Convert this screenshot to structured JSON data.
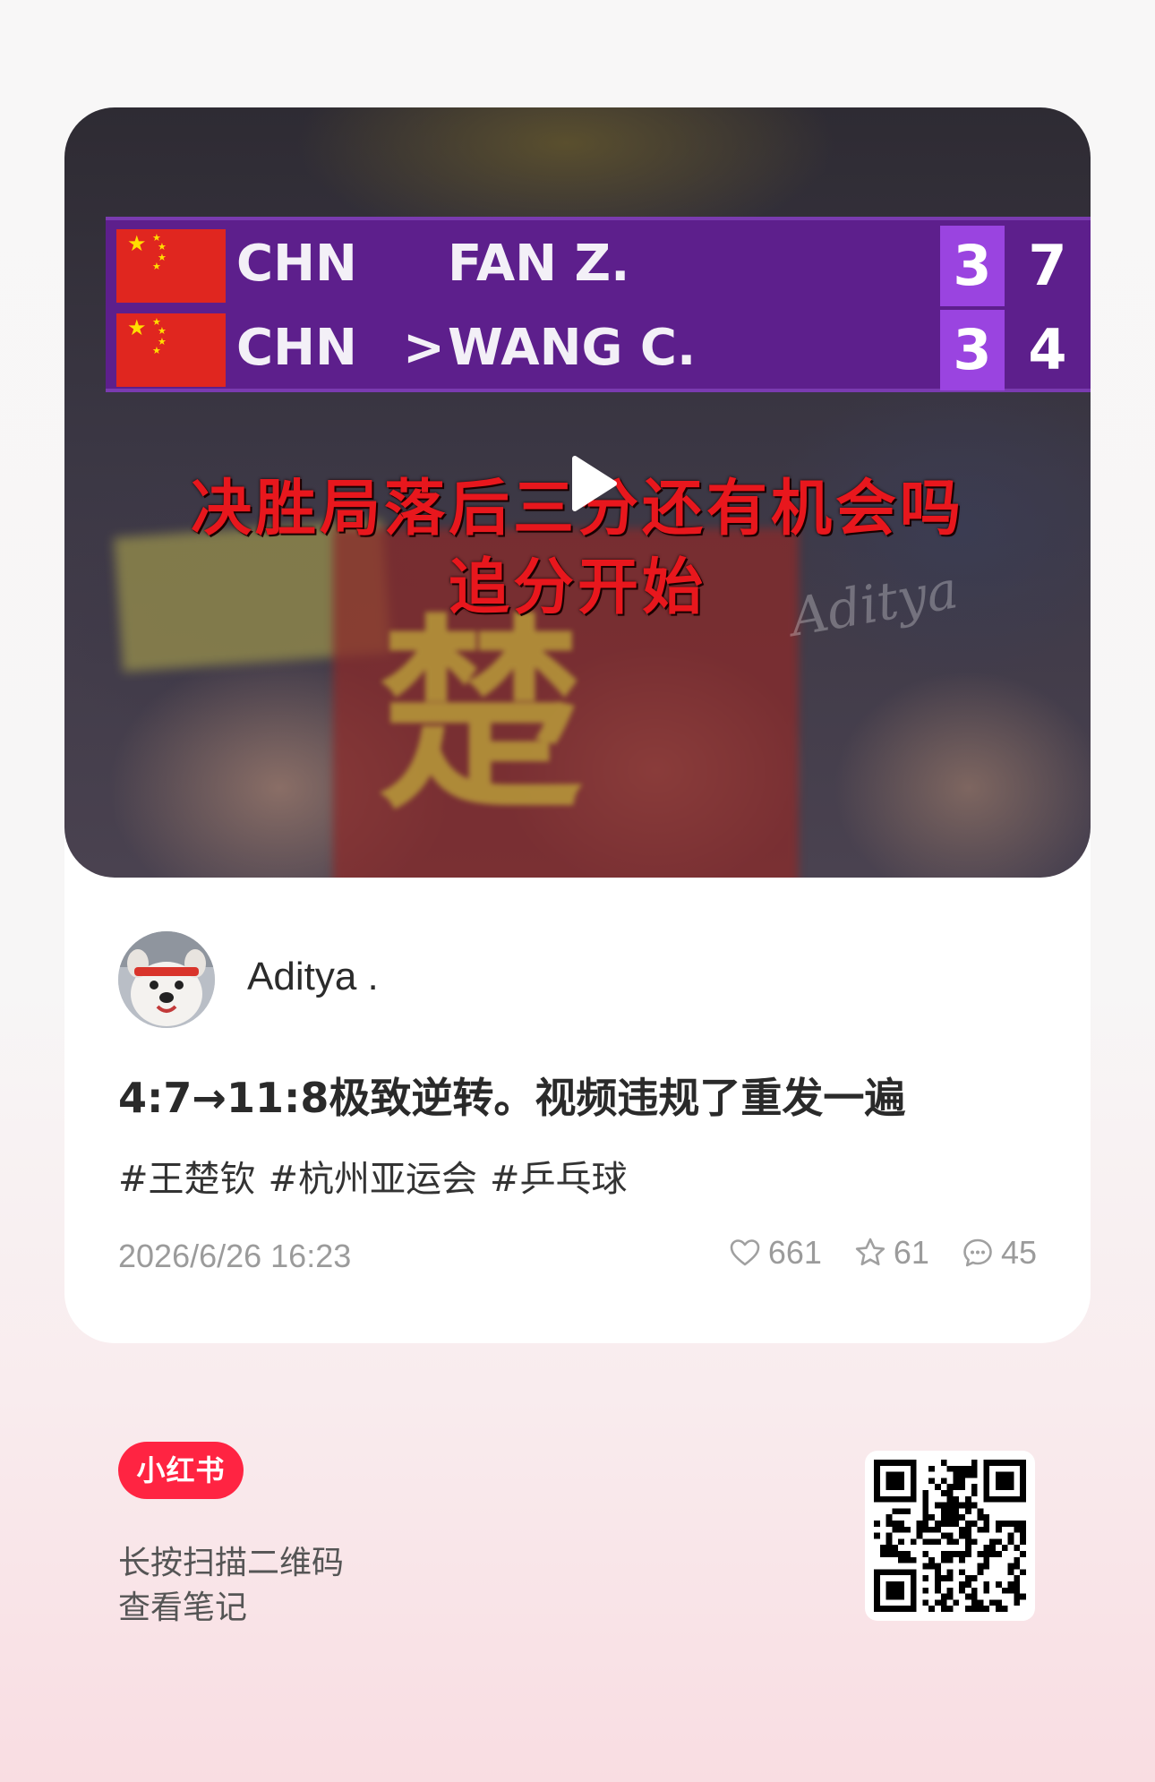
{
  "video": {
    "scoreboard": {
      "rows": [
        {
          "country": "CHN",
          "serve_marker": "",
          "player": "FAN Z.",
          "sets": "3",
          "points": "7"
        },
        {
          "country": "CHN",
          "serve_marker": ">",
          "player": "WANG C.",
          "sets": "3",
          "points": "4"
        }
      ]
    },
    "caption_line1": "决胜局落后三分还有机会吗",
    "caption_line2": "追分开始",
    "watermark": "Aditya",
    "banner_glyph": "楚"
  },
  "author": {
    "name": "Aditya ."
  },
  "post": {
    "title": "4:7→11:8极致逆转。视频违规了重发一遍",
    "tags": [
      "#王楚钦",
      "#杭州亚运会",
      "#乒乓球"
    ],
    "date": "2026/6/26 16:23",
    "likes": "661",
    "collects": "61",
    "comments": "45"
  },
  "footer": {
    "logo": "小红书",
    "line1": "长按扫描二维码",
    "line2": "查看笔记"
  },
  "colors": {
    "brand": "#ff2442",
    "scoreboard": "#5d1f8c",
    "set_box": "#9a44e0",
    "caption": "#e8171d"
  }
}
